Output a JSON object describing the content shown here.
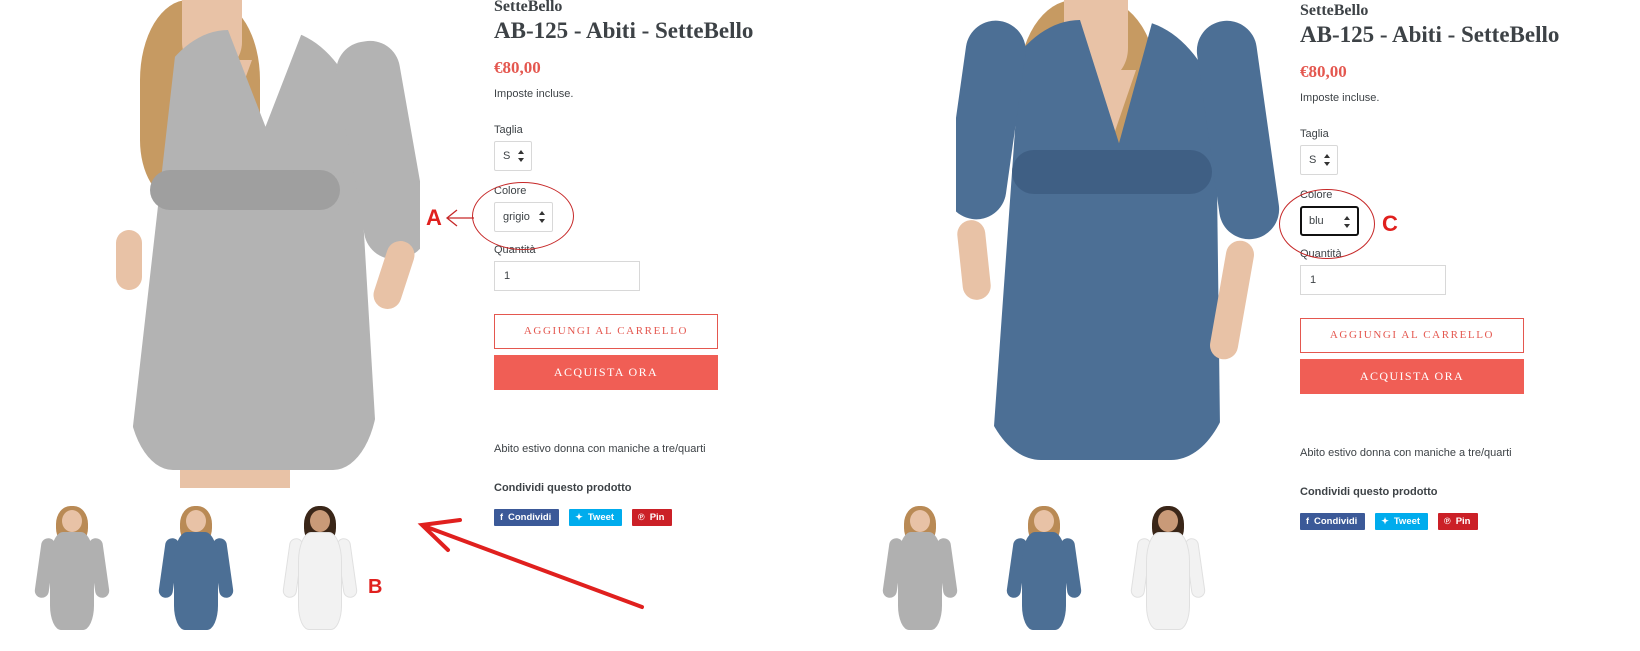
{
  "left_panel": {
    "vendor": "SetteBello",
    "title": "AB-125 - Abiti - SetteBello",
    "price": "€80,00",
    "tax_note": "Imposte incluse.",
    "size_label": "Taglia",
    "size_value": "S",
    "color_label": "Colore",
    "color_value": "grigio",
    "quantity_label": "Quantità",
    "quantity_value": "1",
    "add_to_cart_label": "AGGIUNGI AL CARRELLO",
    "buy_now_label": "ACQUISTA ORA",
    "description": "Abito estivo donna con maniche a tre/quarti",
    "share_title": "Condividi questo prodotto",
    "share_facebook": "Condividi",
    "share_twitter": "Tweet",
    "share_pinterest": "Pin"
  },
  "right_panel": {
    "vendor": "SetteBello",
    "title": "AB-125 - Abiti - SetteBello",
    "price": "€80,00",
    "tax_note": "Imposte incluse.",
    "size_label": "Taglia",
    "size_value": "S",
    "color_label": "Colore",
    "color_value": "blu",
    "quantity_label": "Quantità",
    "quantity_value": "1",
    "add_to_cart_label": "AGGIUNGI AL CARRELLO",
    "buy_now_label": "ACQUISTA ORA",
    "description": "Abito estivo donna con maniche a tre/quarti",
    "share_title": "Condividi questo prodotto",
    "share_facebook": "Condividi",
    "share_twitter": "Tweet",
    "share_pinterest": "Pin"
  },
  "annotations": {
    "a": "A",
    "b": "B",
    "c": "C"
  },
  "colors": {
    "accent": "#e4574f",
    "buy_button": "#f05e55",
    "facebook": "#3b5998",
    "twitter": "#00aced",
    "pinterest": "#cb2027",
    "annotation": "#e0201e",
    "dress_grey": "#b3b3b3",
    "dress_blue": "#4c6f95"
  },
  "icons": {
    "facebook": "facebook-icon",
    "twitter": "twitter-icon",
    "pinterest": "pinterest-icon",
    "select_arrows": "select-arrows-icon"
  }
}
